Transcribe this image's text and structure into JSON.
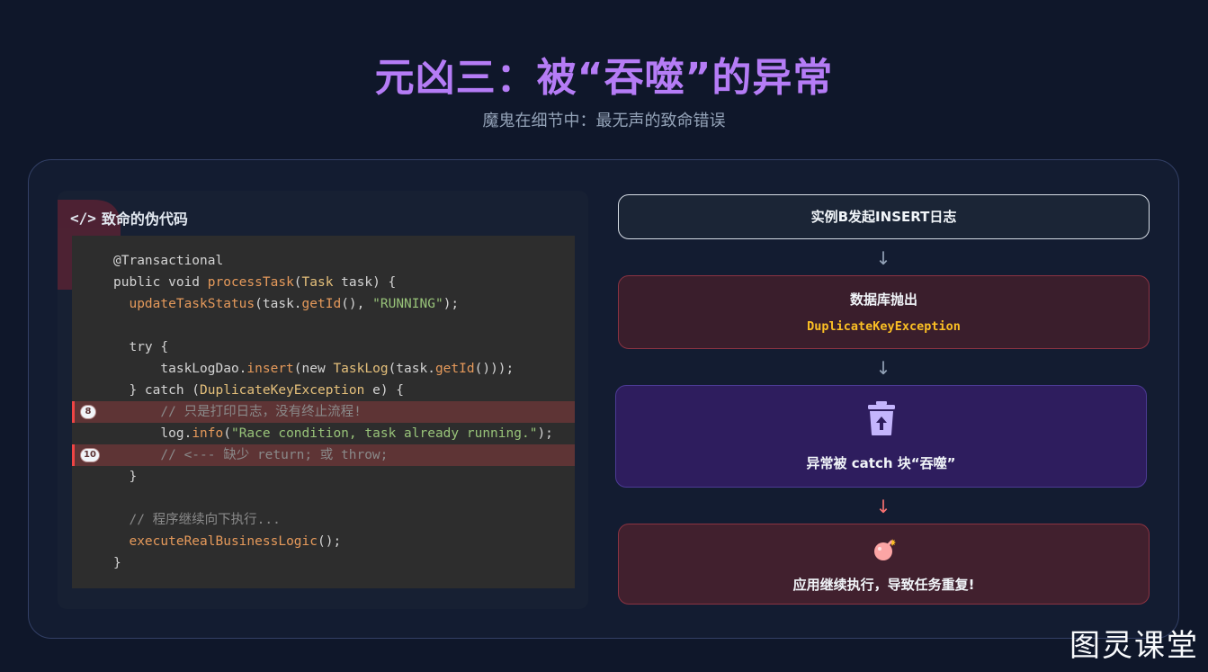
{
  "header": {
    "title": "元凶三：被“吞噬”的异常",
    "subtitle": "魔鬼在细节中：最无声的致命错误"
  },
  "code_card": {
    "title": "致命的伪代码",
    "icon": "code-icon",
    "lines": [
      [
        {
          "t": "@Transactional",
          "c": ""
        }
      ],
      [
        {
          "t": "public void ",
          "c": ""
        },
        {
          "t": "processTask",
          "c": "fn"
        },
        {
          "t": "(",
          "c": ""
        },
        {
          "t": "Task",
          "c": "cls"
        },
        {
          "t": " task) {",
          "c": ""
        }
      ],
      [
        {
          "t": "  ",
          "c": ""
        },
        {
          "t": "updateTaskStatus",
          "c": "fn"
        },
        {
          "t": "(task.",
          "c": ""
        },
        {
          "t": "getId",
          "c": "fn"
        },
        {
          "t": "(), ",
          "c": ""
        },
        {
          "t": "\"RUNNING\"",
          "c": "str"
        },
        {
          "t": ");",
          "c": ""
        }
      ],
      [
        {
          "t": "",
          "c": ""
        }
      ],
      [
        {
          "t": "  try {",
          "c": ""
        }
      ],
      [
        {
          "t": "      taskLogDao.",
          "c": ""
        },
        {
          "t": "insert",
          "c": "fn"
        },
        {
          "t": "(new ",
          "c": ""
        },
        {
          "t": "TaskLog",
          "c": "cls"
        },
        {
          "t": "(task.",
          "c": ""
        },
        {
          "t": "getId",
          "c": "fn"
        },
        {
          "t": "()));",
          "c": ""
        }
      ],
      [
        {
          "t": "  } catch (",
          "c": ""
        },
        {
          "t": "DuplicateKeyException",
          "c": "cls"
        },
        {
          "t": " e) {",
          "c": ""
        }
      ],
      [
        {
          "t": "      // 只是打印日志，没有终止流程!",
          "c": "com"
        }
      ],
      [
        {
          "t": "      log.",
          "c": ""
        },
        {
          "t": "info",
          "c": "fn"
        },
        {
          "t": "(",
          "c": ""
        },
        {
          "t": "\"Race condition, task already running.\"",
          "c": "str"
        },
        {
          "t": ");",
          "c": ""
        }
      ],
      [
        {
          "t": "      // <--- 缺少 return; 或 throw;",
          "c": "com"
        }
      ],
      [
        {
          "t": "  }",
          "c": ""
        }
      ],
      [
        {
          "t": "",
          "c": ""
        }
      ],
      [
        {
          "t": "  // 程序继续向下执行...",
          "c": "com"
        }
      ],
      [
        {
          "t": "  ",
          "c": ""
        },
        {
          "t": "executeRealBusinessLogic",
          "c": "fn"
        },
        {
          "t": "();",
          "c": ""
        }
      ],
      [
        {
          "t": "}",
          "c": ""
        }
      ]
    ],
    "highlighted_lines": [
      {
        "index": 7,
        "badge": "8"
      },
      {
        "index": 9,
        "badge": "10"
      }
    ]
  },
  "flow": {
    "step1": "实例B发起INSERT日志",
    "step2_title": "数据库抛出",
    "step2_code": "DuplicateKeyException",
    "step3_icon": "trash-restore-icon",
    "step3_title": "异常被 catch 块“吞噬”",
    "step4_icon": "bomb-icon",
    "step4_title": "应用继续执行，导致任务重复!",
    "arrow": "↓"
  },
  "watermark": "图灵课堂",
  "colors": {
    "title": "#b57cf6",
    "highlight_bg": "#5e3435",
    "highlight_bar": "#ef4444",
    "exception_code": "#fbbf24"
  }
}
